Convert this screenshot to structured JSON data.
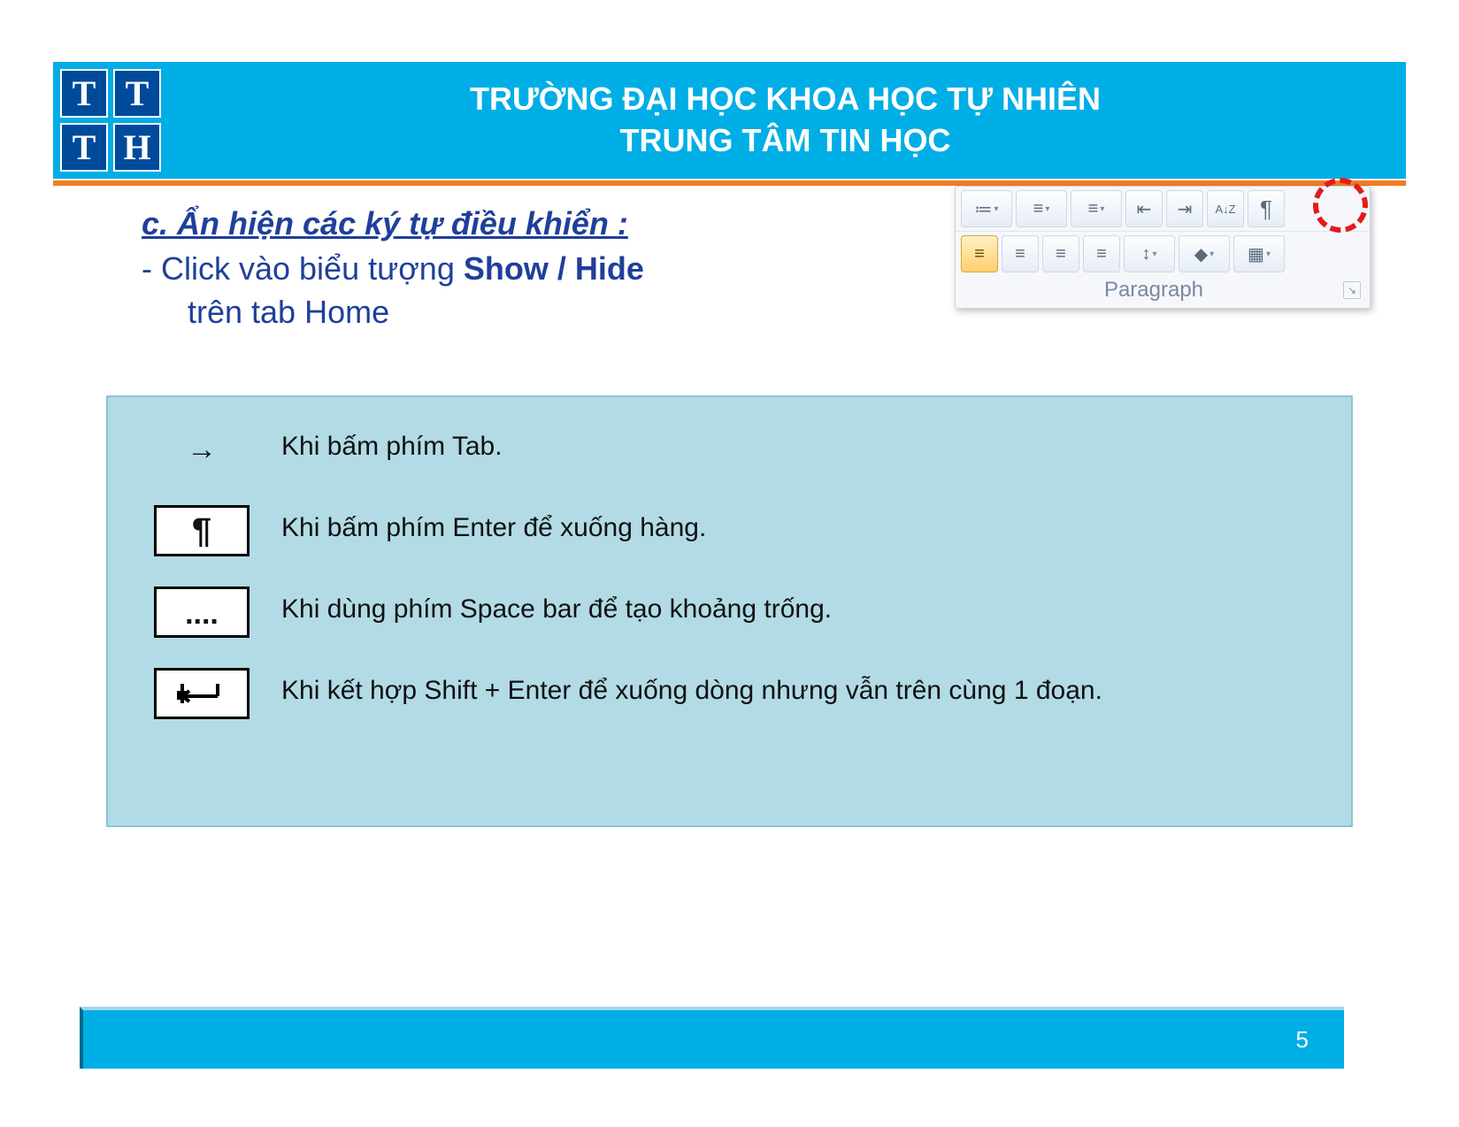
{
  "header": {
    "line1": "TRƯỜNG ĐẠI HỌC KHOA HỌC TỰ NHIÊN",
    "line2": "TRUNG TÂM TIN HỌC",
    "logo": [
      "T",
      "T",
      "T",
      "H"
    ]
  },
  "section": {
    "heading": "c. Ẩn hiện các ký tự điều khiển :",
    "instruction_prefix": "- Click vào biểu tượng ",
    "instruction_bold": "Show / Hide",
    "instruction_suffix": " trên tab Home"
  },
  "ribbon": {
    "group_label": "Paragraph",
    "row1": [
      {
        "glyph": "≔",
        "drop": true,
        "name": "bullet-list"
      },
      {
        "glyph": "≡",
        "drop": true,
        "name": "number-list"
      },
      {
        "glyph": "≡",
        "drop": true,
        "name": "multilevel-list"
      },
      {
        "glyph": "⇤",
        "name": "decrease-indent"
      },
      {
        "glyph": "⇥",
        "name": "increase-indent"
      },
      {
        "glyph": "A↓Z",
        "name": "sort"
      },
      {
        "glyph": "¶",
        "name": "show-hide"
      }
    ],
    "row2": [
      {
        "glyph": "≡",
        "active": true,
        "name": "align-left"
      },
      {
        "glyph": "≡",
        "name": "align-center"
      },
      {
        "glyph": "≡",
        "name": "align-right"
      },
      {
        "glyph": "≡",
        "name": "justify"
      },
      {
        "glyph": "↕",
        "drop": true,
        "name": "line-spacing"
      },
      {
        "glyph": "◆",
        "drop": true,
        "name": "shading"
      },
      {
        "glyph": "▦",
        "drop": true,
        "name": "borders"
      }
    ]
  },
  "info": {
    "rows": [
      {
        "icon": "→",
        "boxed": false,
        "text": "Khi bấm phím Tab."
      },
      {
        "icon": "¶",
        "boxed": true,
        "text": "Khi bấm phím Enter để xuống hàng."
      },
      {
        "icon": "....",
        "boxed": true,
        "text": "Khi dùng phím Space bar để tạo khoảng trống."
      },
      {
        "icon": "↲",
        "boxed": true,
        "text": "Khi kết hợp Shift + Enter để xuống dòng nhưng vẫn trên cùng 1 đoạn."
      }
    ]
  },
  "footer": {
    "page_number": "5"
  }
}
